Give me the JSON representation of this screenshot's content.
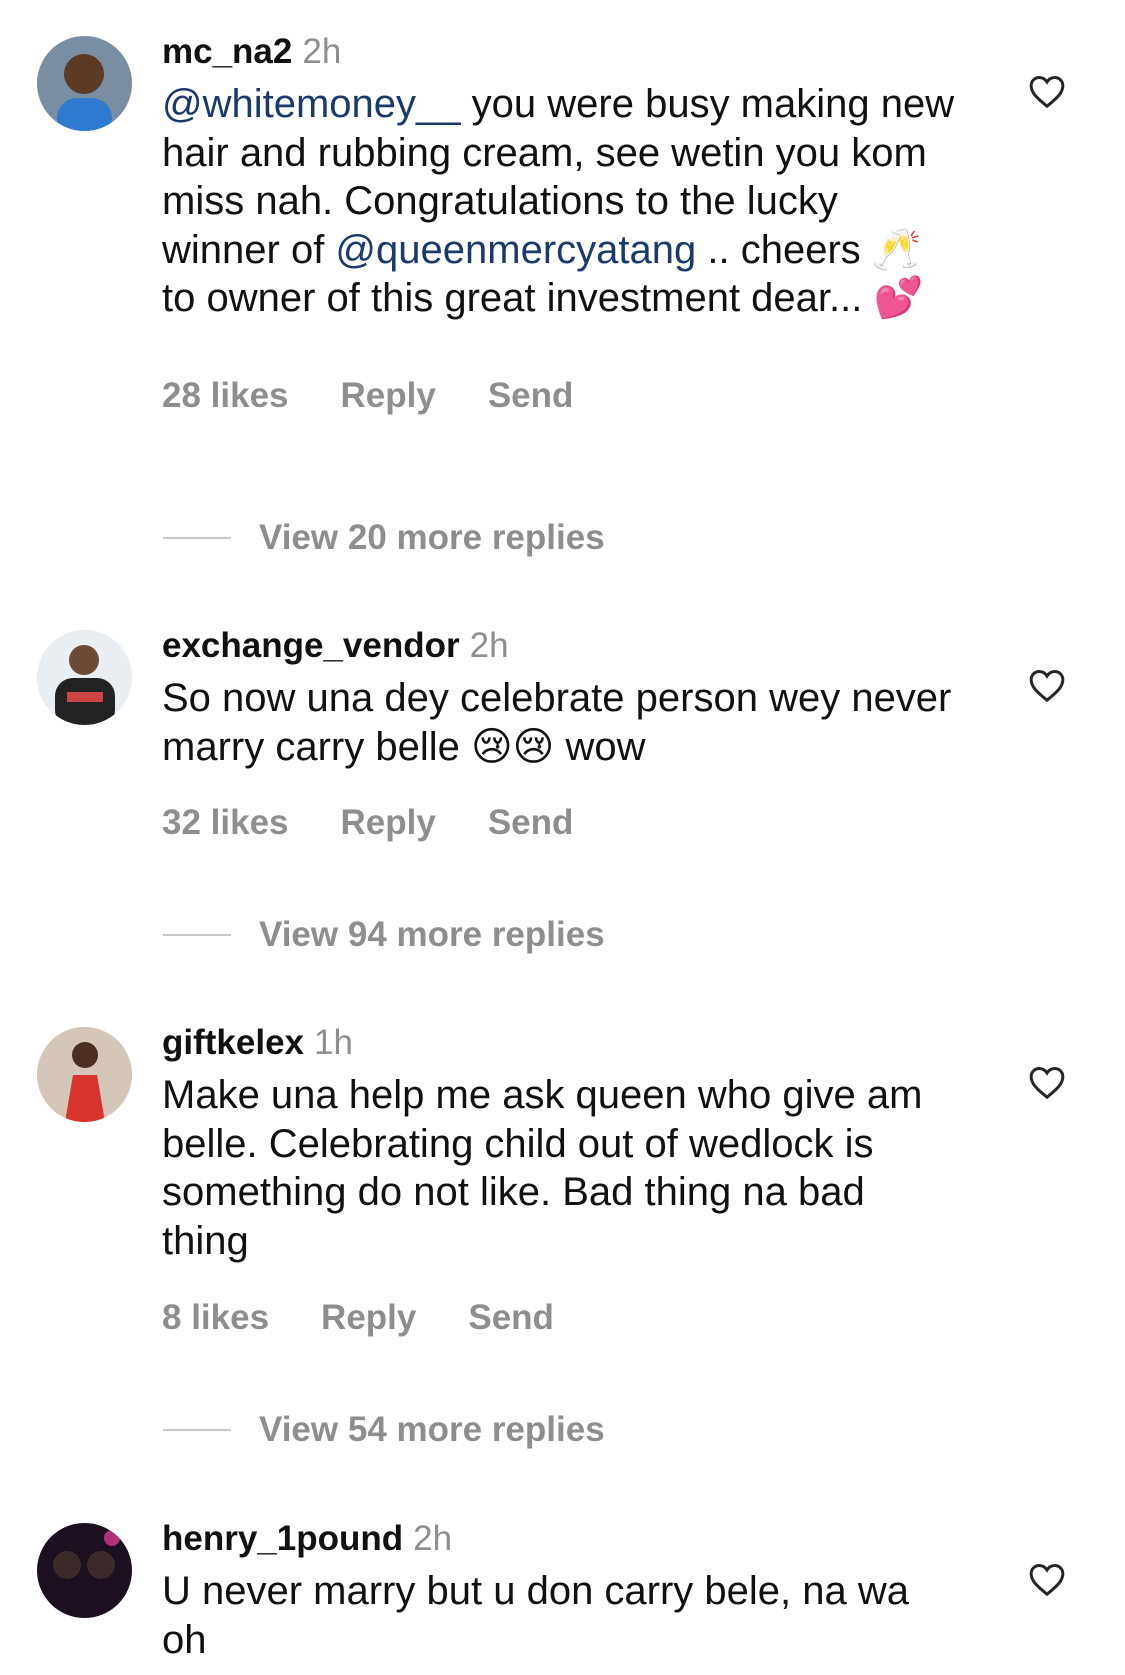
{
  "comments": [
    {
      "username": "mc_na2",
      "time": "2h",
      "text_parts": [
        {
          "mention": "@whitemoney__"
        },
        {
          "text": " you were busy making new hair and rubbing cream, see wetin you kom miss nah. Congratulations to the lucky winner of "
        },
        {
          "mention": "@queenmercyatang"
        },
        {
          "text": " .. cheers 🥂 to owner of this great investment dear... 💕"
        }
      ],
      "likes": "28 likes",
      "reply": "Reply",
      "send": "Send",
      "view_replies": "View 20 more replies",
      "avatar_icon": "avatar-man-blue"
    },
    {
      "username": "exchange_vendor",
      "time": "2h",
      "text_parts": [
        {
          "text": "So now una dey celebrate person wey never marry carry belle 😢😢 wow"
        }
      ],
      "likes": "32 likes",
      "reply": "Reply",
      "send": "Send",
      "view_replies": "View 94 more replies",
      "avatar_icon": "avatar-man-jersey"
    },
    {
      "username": "giftkelex",
      "time": "1h",
      "text_parts": [
        {
          "text": "Make una help me ask queen who give am belle. Celebrating child out of wedlock is something do not like. Bad thing na bad thing"
        }
      ],
      "likes": "8 likes",
      "reply": "Reply",
      "send": "Send",
      "view_replies": "View 54 more replies",
      "avatar_icon": "avatar-woman-red"
    },
    {
      "username": "henry_1pound",
      "time": "2h",
      "text_parts": [
        {
          "text": "U never marry but u don carry bele, na wa oh"
        }
      ],
      "avatar_icon": "avatar-dark-party"
    }
  ],
  "colors": {
    "mention": "#1a3a6b",
    "muted": "#8e8e8e",
    "text": "#111111"
  }
}
